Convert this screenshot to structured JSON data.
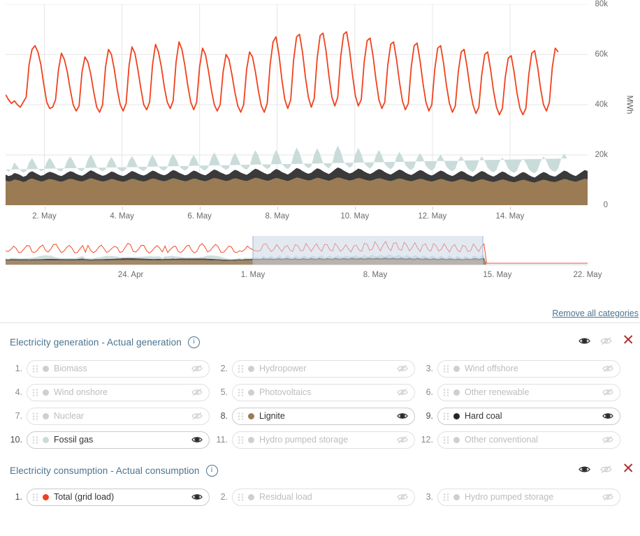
{
  "chart_data": {
    "type": "area",
    "title": "",
    "xlabel": "",
    "ylabel": "MWh",
    "ylim": [
      0,
      80000
    ],
    "yticks": [
      "0",
      "20k",
      "40k",
      "60k",
      "80k"
    ],
    "ytick_values": [
      0,
      20000,
      40000,
      60000,
      80000
    ],
    "xticks": [
      "2. May",
      "4. May",
      "6. May",
      "8. May",
      "10. May",
      "12. May",
      "14. May"
    ],
    "grid": true,
    "legend_position": "below-chart",
    "stacked_series": [
      {
        "name": "Lignite",
        "color": "#9b7b54",
        "values": [
          9800,
          9400,
          9600,
          10200,
          10000,
          9700,
          9200,
          9500,
          10300,
          10600,
          10200,
          9800,
          9400,
          9600,
          10100,
          10400,
          10200,
          9900,
          9500,
          9300,
          9700,
          10200,
          10500,
          10300,
          9900,
          9600,
          9400,
          9800,
          10300,
          10700,
          10400,
          10000,
          9700,
          9400,
          9600,
          10000,
          10400,
          10200,
          9800,
          9500,
          9300,
          9600,
          10100,
          10500,
          10300,
          9900,
          9600,
          9400,
          9700,
          10200,
          10600,
          10400,
          10000,
          9700,
          9500,
          9800,
          10300,
          10700,
          10500,
          10100,
          9800,
          9500,
          9700,
          10200,
          10600,
          10400,
          10000,
          9700,
          9500,
          9900,
          10400,
          10800,
          10600,
          10200,
          9900,
          9600,
          9800,
          10300,
          10700,
          10500,
          10100,
          9800,
          9600,
          10000,
          10500,
          10900,
          10700,
          10300,
          10000,
          9700,
          9900,
          10400,
          10800,
          10600,
          10200,
          9900,
          9600,
          10000,
          10500,
          11000,
          10800,
          10400,
          10100,
          9800,
          10000,
          10500,
          10900,
          10700,
          10300,
          10000,
          9700,
          10100,
          10600,
          11000,
          10800,
          10400,
          10100,
          9800,
          10000,
          10400,
          10800,
          10600,
          10200,
          9900,
          9700,
          10000,
          10400,
          10700,
          10500,
          10100,
          9800,
          9600,
          9900,
          10300,
          10600,
          10400,
          10000,
          9700,
          9500,
          9800,
          10200,
          10500,
          10300,
          9900,
          9600,
          9400,
          9700,
          10100,
          10400,
          10200,
          9800,
          9500,
          9300,
          9600,
          10000,
          10300,
          10100,
          9700,
          9400,
          9200,
          9600,
          10000,
          10300,
          10100,
          9700,
          9400,
          9200,
          9500,
          9900,
          10200,
          10000,
          9600,
          9300,
          9100,
          9400,
          9800,
          10100,
          9900,
          9500,
          9200,
          9000,
          9400,
          9800,
          10100,
          9900,
          9500,
          9300,
          9200,
          9600,
          10000,
          10400,
          10200,
          9800,
          9500,
          9300,
          9700,
          10100,
          10500,
          10300
        ]
      },
      {
        "name": "Hard coal",
        "color": "#3a3a3a",
        "values": [
          2400,
          2200,
          2300,
          2600,
          2500,
          2300,
          2100,
          2200,
          2700,
          2900,
          2700,
          2500,
          2300,
          2400,
          2700,
          2900,
          2800,
          2600,
          2400,
          2300,
          2500,
          2800,
          3000,
          2900,
          2600,
          2400,
          2300,
          2500,
          2900,
          3200,
          3000,
          2700,
          2500,
          2300,
          2400,
          2700,
          3000,
          2900,
          2600,
          2400,
          2300,
          2500,
          2800,
          3100,
          2900,
          2700,
          2500,
          2400,
          2600,
          2900,
          3200,
          3000,
          2700,
          2500,
          2400,
          2600,
          3000,
          3300,
          3100,
          2800,
          2600,
          2400,
          2500,
          2900,
          3200,
          3000,
          2700,
          2500,
          2400,
          2700,
          3100,
          3400,
          3200,
          2900,
          2700,
          2500,
          2600,
          3000,
          3400,
          3200,
          2900,
          2700,
          2500,
          2800,
          3300,
          3600,
          3400,
          3100,
          2800,
          2600,
          2700,
          3200,
          3600,
          3400,
          3000,
          2800,
          2600,
          2900,
          3400,
          3800,
          3600,
          3200,
          2900,
          2700,
          2900,
          3400,
          3800,
          3600,
          3200,
          2900,
          2700,
          3100,
          3600,
          4000,
          3800,
          3400,
          3100,
          2800,
          3000,
          3400,
          3800,
          3600,
          3200,
          2900,
          2700,
          3000,
          3400,
          3700,
          3500,
          3100,
          2800,
          2600,
          2900,
          3300,
          3600,
          3400,
          3000,
          2700,
          2500,
          2800,
          3200,
          3500,
          3300,
          2900,
          2600,
          2400,
          2700,
          3100,
          3400,
          3200,
          2800,
          2500,
          2300,
          2600,
          3000,
          3300,
          3100,
          2700,
          2400,
          2200,
          2600,
          3000,
          3300,
          3100,
          2700,
          2400,
          2200,
          2500,
          2900,
          3200,
          3000,
          2600,
          2300,
          2100,
          2400,
          2800,
          3100,
          2900,
          2500,
          2200,
          2000,
          2400,
          2800,
          3100,
          2900,
          2500,
          2300,
          2200,
          2600,
          3000,
          3400,
          3200,
          2800,
          2500,
          2300,
          2700,
          3100,
          3500,
          3300
        ]
      },
      {
        "name": "Fossil gas",
        "color": "#c9dcda",
        "values": [
          2000,
          1800,
          2400,
          4200,
          3000,
          2000,
          1700,
          1900,
          4000,
          5200,
          3800,
          2200,
          1800,
          2000,
          4400,
          5600,
          4200,
          2400,
          1900,
          1800,
          2600,
          4800,
          5800,
          4400,
          2600,
          2000,
          1800,
          2400,
          5000,
          6200,
          4600,
          2600,
          2000,
          1800,
          2200,
          4600,
          5800,
          4200,
          2400,
          1900,
          1800,
          2400,
          4800,
          6000,
          4400,
          2500,
          2000,
          1800,
          2400,
          5000,
          6200,
          4600,
          2600,
          2000,
          1900,
          2500,
          5200,
          6400,
          4800,
          2700,
          2100,
          1900,
          2300,
          5000,
          6200,
          4600,
          2600,
          2000,
          1900,
          2600,
          5400,
          6800,
          5000,
          2800,
          2200,
          2000,
          2400,
          5400,
          6800,
          5000,
          2800,
          2200,
          2000,
          2600,
          5800,
          7400,
          5600,
          3000,
          2400,
          2100,
          2500,
          5800,
          7600,
          5800,
          3200,
          2400,
          2100,
          2700,
          6200,
          8200,
          6400,
          3400,
          2600,
          2200,
          2600,
          6200,
          8000,
          6000,
          3200,
          2500,
          2200,
          3000,
          6800,
          8800,
          6800,
          3600,
          2800,
          2300,
          2700,
          6400,
          8200,
          6200,
          3300,
          2600,
          2200,
          2800,
          6000,
          7600,
          5800,
          3200,
          2500,
          2100,
          2600,
          5600,
          7000,
          5400,
          3000,
          2300,
          2000,
          2500,
          5400,
          6800,
          5200,
          2900,
          2200,
          1900,
          2400,
          5200,
          6400,
          4800,
          2700,
          2100,
          1900,
          2300,
          4800,
          6000,
          4600,
          2600,
          2000,
          1800,
          2200,
          4600,
          5800,
          4400,
          2500,
          1900,
          1700,
          2100,
          4400,
          5600,
          4200,
          2400,
          1900,
          1700,
          2000,
          4200,
          5400,
          4000,
          2300,
          1800,
          1700,
          2200,
          4800,
          6200,
          4800,
          2700,
          2100,
          1900,
          2400,
          5400,
          6800,
          5200
        ]
      }
    ],
    "line_series": [
      {
        "name": "Total (grid load)",
        "color": "#f0411c",
        "values": [
          44000,
          42000,
          40500,
          41500,
          40000,
          39000,
          41000,
          43000,
          56000,
          62000,
          63500,
          61000,
          56000,
          48000,
          41000,
          38500,
          39000,
          42000,
          54000,
          60500,
          58000,
          53000,
          46000,
          40000,
          37500,
          39500,
          53000,
          59000,
          57000,
          52000,
          45000,
          39000,
          37000,
          40000,
          55000,
          62000,
          60000,
          54000,
          46000,
          40000,
          37500,
          40500,
          55500,
          63000,
          60500,
          54000,
          46500,
          40000,
          38000,
          41000,
          56000,
          64000,
          61000,
          55000,
          47000,
          41000,
          38500,
          41500,
          57000,
          65000,
          62000,
          55500,
          47500,
          41000,
          38000,
          41000,
          55000,
          62500,
          60000,
          53500,
          46000,
          40000,
          37500,
          40000,
          53000,
          60000,
          58000,
          52000,
          45000,
          39500,
          37000,
          40000,
          54000,
          61000,
          59000,
          53000,
          45500,
          39500,
          37000,
          40500,
          56000,
          65000,
          67000,
          60000,
          50000,
          42000,
          38500,
          42000,
          58000,
          67000,
          68000,
          61000,
          51000,
          43000,
          39000,
          42500,
          58500,
          67500,
          68500,
          61500,
          51500,
          43000,
          39500,
          43000,
          59000,
          68000,
          69000,
          62000,
          52000,
          43500,
          39500,
          42000,
          57000,
          65500,
          66500,
          59500,
          50000,
          42000,
          38500,
          41000,
          55500,
          64000,
          65000,
          58000,
          49000,
          41500,
          38000,
          40500,
          55000,
          63500,
          64500,
          57500,
          48500,
          41000,
          37500,
          40000,
          54000,
          62500,
          63500,
          56500,
          47500,
          40500,
          37000,
          39500,
          53000,
          61000,
          62000,
          55000,
          46500,
          40000,
          36500,
          39000,
          52000,
          60000,
          61000,
          54000,
          45500,
          39000,
          36000,
          38500,
          51000,
          58500,
          59500,
          53000,
          44500,
          38500,
          36000,
          38500,
          52000,
          60500,
          61500,
          55000,
          46500,
          40000,
          37500,
          41000,
          55000,
          62500,
          61000
        ]
      }
    ],
    "navigator": {
      "xticks": [
        "24. Apr",
        "1. May",
        "8. May",
        "15. May",
        "22. May"
      ],
      "selection_start_label": "1. May",
      "selection_end_label": "15. May",
      "selection_color": "#ccd7e6"
    }
  },
  "toolbar": {
    "remove_all_label": "Remove all categories"
  },
  "sections": [
    {
      "title": "Electricity generation - Actual generation",
      "info_icon": "info-icon",
      "show_all_icon": "eye-icon",
      "hide_all_icon": "eye-off-icon",
      "remove_icon": "close-icon",
      "items": [
        {
          "index": "1.",
          "label": "Biomass",
          "color": "#cfcfcf",
          "active": false,
          "eye": "eye-off-icon"
        },
        {
          "index": "2.",
          "label": "Hydropower",
          "color": "#cfcfcf",
          "active": false,
          "eye": "eye-off-icon"
        },
        {
          "index": "3.",
          "label": "Wind offshore",
          "color": "#cfcfcf",
          "active": false,
          "eye": "eye-off-icon"
        },
        {
          "index": "4.",
          "label": "Wind onshore",
          "color": "#cfcfcf",
          "active": false,
          "eye": "eye-off-icon"
        },
        {
          "index": "5.",
          "label": "Photovoltaics",
          "color": "#cfcfcf",
          "active": false,
          "eye": "eye-off-icon"
        },
        {
          "index": "6.",
          "label": "Other renewable",
          "color": "#cfcfcf",
          "active": false,
          "eye": "eye-off-icon"
        },
        {
          "index": "7.",
          "label": "Nuclear",
          "color": "#cfcfcf",
          "active": false,
          "eye": "eye-off-icon"
        },
        {
          "index": "8.",
          "label": "Lignite",
          "color": "#9b7b54",
          "active": true,
          "eye": "eye-icon"
        },
        {
          "index": "9.",
          "label": "Hard coal",
          "color": "#262626",
          "active": true,
          "eye": "eye-icon"
        },
        {
          "index": "10.",
          "label": "Fossil gas",
          "color": "#c9dcda",
          "active": true,
          "eye": "eye-icon"
        },
        {
          "index": "11.",
          "label": "Hydro pumped storage",
          "color": "#cfcfcf",
          "active": false,
          "eye": "eye-off-icon"
        },
        {
          "index": "12.",
          "label": "Other conventional",
          "color": "#cfcfcf",
          "active": false,
          "eye": "eye-off-icon"
        }
      ]
    },
    {
      "title": "Electricity consumption - Actual consumption",
      "info_icon": "info-icon",
      "show_all_icon": "eye-icon",
      "hide_all_icon": "eye-off-icon",
      "remove_icon": "close-icon",
      "items": [
        {
          "index": "1.",
          "label": "Total (grid load)",
          "color": "#f0411c",
          "active": true,
          "eye": "eye-icon"
        },
        {
          "index": "2.",
          "label": "Residual load",
          "color": "#cfcfcf",
          "active": false,
          "eye": "eye-off-icon"
        },
        {
          "index": "3.",
          "label": "Hydro pumped storage",
          "color": "#cfcfcf",
          "active": false,
          "eye": "eye-off-icon"
        }
      ]
    }
  ],
  "colors": {
    "accent_link": "#4a7390",
    "remove": "#b03030",
    "grid": "#e6e6e6"
  }
}
